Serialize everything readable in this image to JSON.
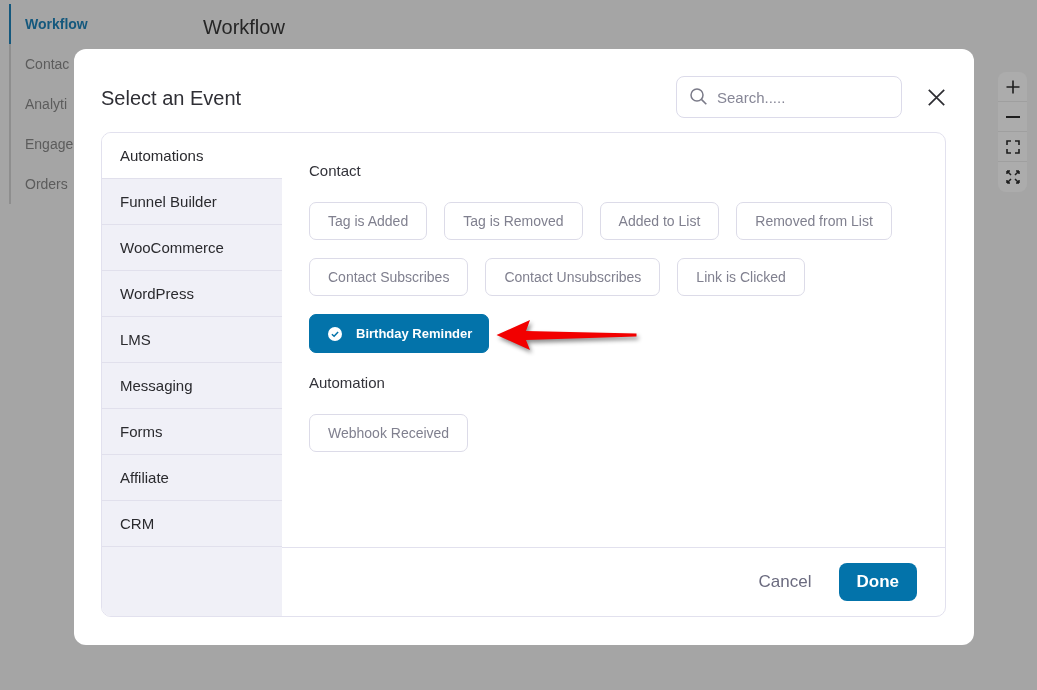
{
  "background": {
    "nav_items": [
      {
        "label": "Workflow",
        "selected": true
      },
      {
        "label": "Contac",
        "selected": false
      },
      {
        "label": "Analyti",
        "selected": false
      },
      {
        "label": "Engage",
        "selected": false
      },
      {
        "label": "Orders",
        "selected": false
      }
    ],
    "heading": "Workflow"
  },
  "dialog": {
    "title": "Select an Event",
    "search": {
      "placeholder": "Search....."
    },
    "categories": [
      {
        "label": "Automations",
        "selected": true
      },
      {
        "label": "Funnel Builder",
        "selected": false
      },
      {
        "label": "WooCommerce",
        "selected": false
      },
      {
        "label": "WordPress",
        "selected": false
      },
      {
        "label": "LMS",
        "selected": false
      },
      {
        "label": "Messaging",
        "selected": false
      },
      {
        "label": "Forms",
        "selected": false
      },
      {
        "label": "Affiliate",
        "selected": false
      },
      {
        "label": "CRM",
        "selected": false
      }
    ],
    "sections": [
      {
        "title": "Contact",
        "events": [
          {
            "label": "Tag is Added",
            "selected": false
          },
          {
            "label": "Tag is Removed",
            "selected": false
          },
          {
            "label": "Added to List",
            "selected": false
          },
          {
            "label": "Removed from List",
            "selected": false
          },
          {
            "label": "Contact Subscribes",
            "selected": false
          },
          {
            "label": "Contact Unsubscribes",
            "selected": false
          },
          {
            "label": "Link is Clicked",
            "selected": false
          },
          {
            "label": "Birthday Reminder",
            "selected": true
          }
        ]
      },
      {
        "title": "Automation",
        "events": [
          {
            "label": "Webhook Received",
            "selected": false
          }
        ]
      }
    ],
    "buttons": [
      {
        "label": "Cancel",
        "kind": "secondary"
      },
      {
        "label": "Done",
        "kind": "primary"
      }
    ]
  }
}
